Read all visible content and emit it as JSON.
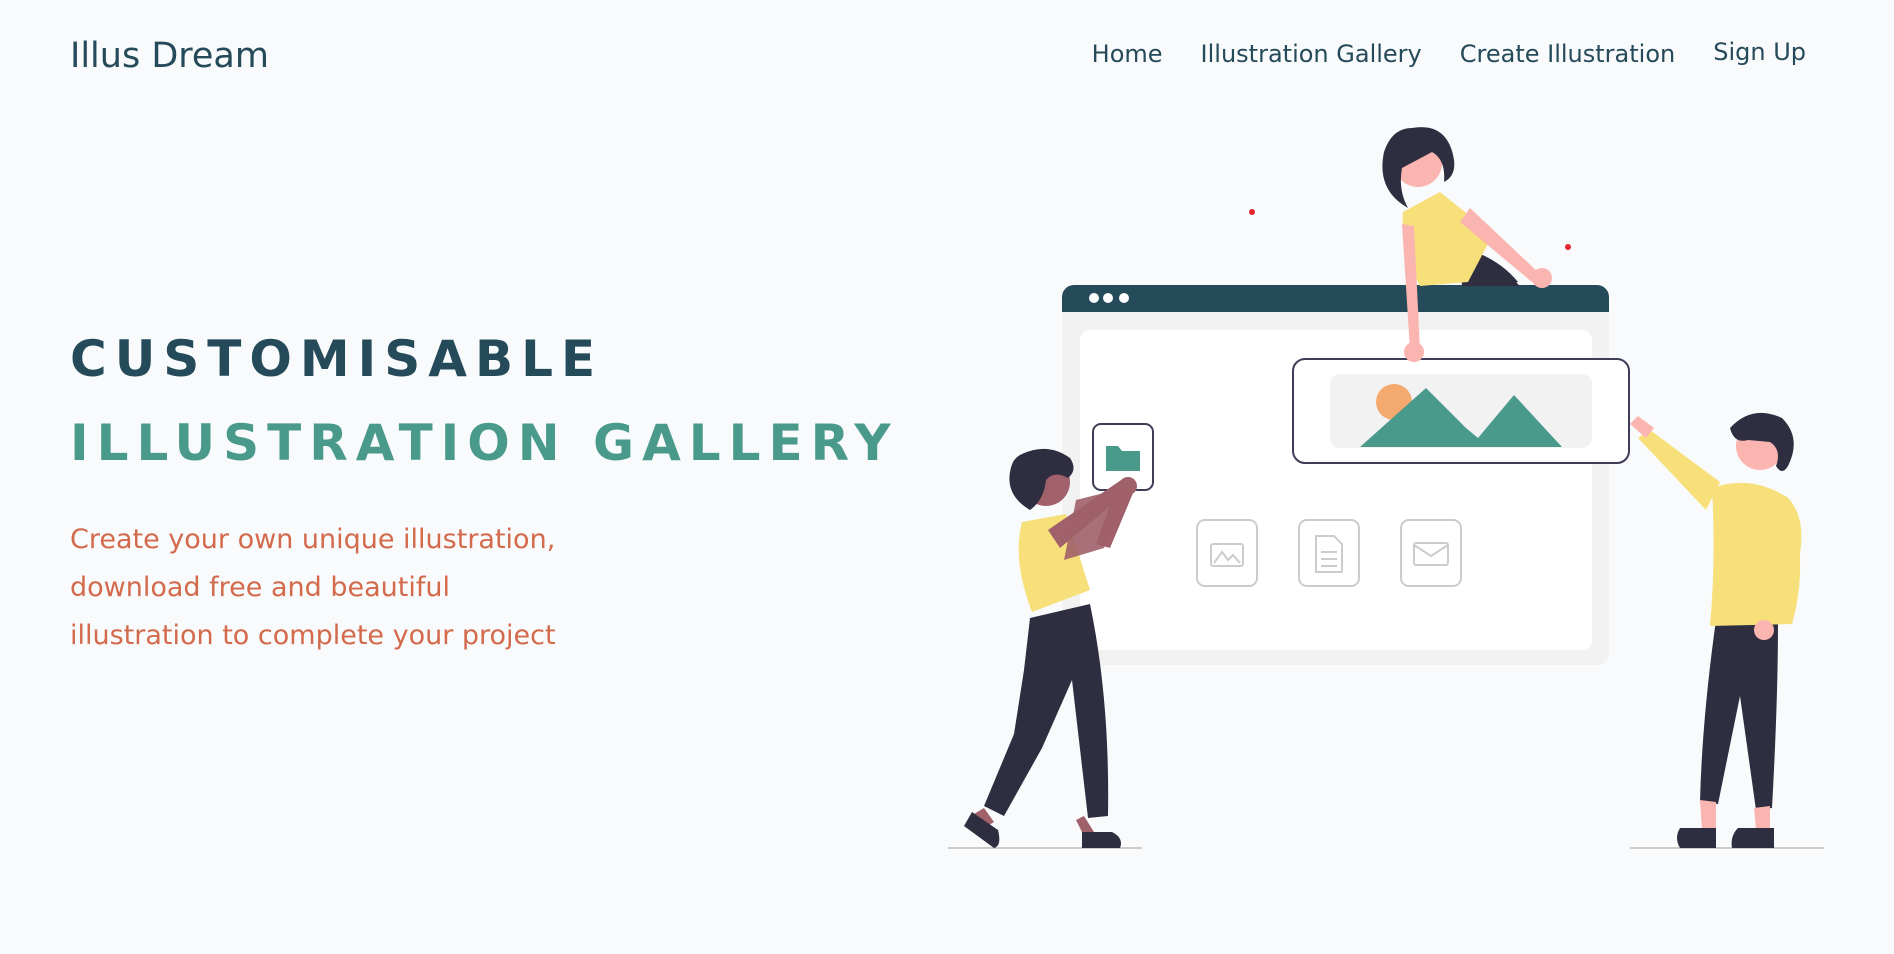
{
  "header": {
    "logo": "Illus Dream",
    "nav": [
      {
        "label": "Home"
      },
      {
        "label": "Illustration Gallery"
      },
      {
        "label": "Create Illustration"
      },
      {
        "label": "Sign Up"
      }
    ]
  },
  "hero": {
    "title_line1": "CUSTOMISABLE",
    "title_line2": "ILLUSTRATION GALLERY",
    "description_lines": [
      "Create your own unique illustration,",
      "download free and beautiful",
      "illustration to complete your project"
    ]
  },
  "colors": {
    "background": "#f8fafb",
    "primary_dark": "#254a5a",
    "accent_teal": "#4a9a8c",
    "accent_orange": "#d36a4c",
    "yellow": "#f7e07a",
    "skin": "#fbb5b0",
    "dark_figure": "#2f2e41"
  },
  "illustration": {
    "icons": [
      "folder-icon",
      "image-icon",
      "document-icon",
      "mail-icon",
      "landscape-image-icon"
    ]
  }
}
